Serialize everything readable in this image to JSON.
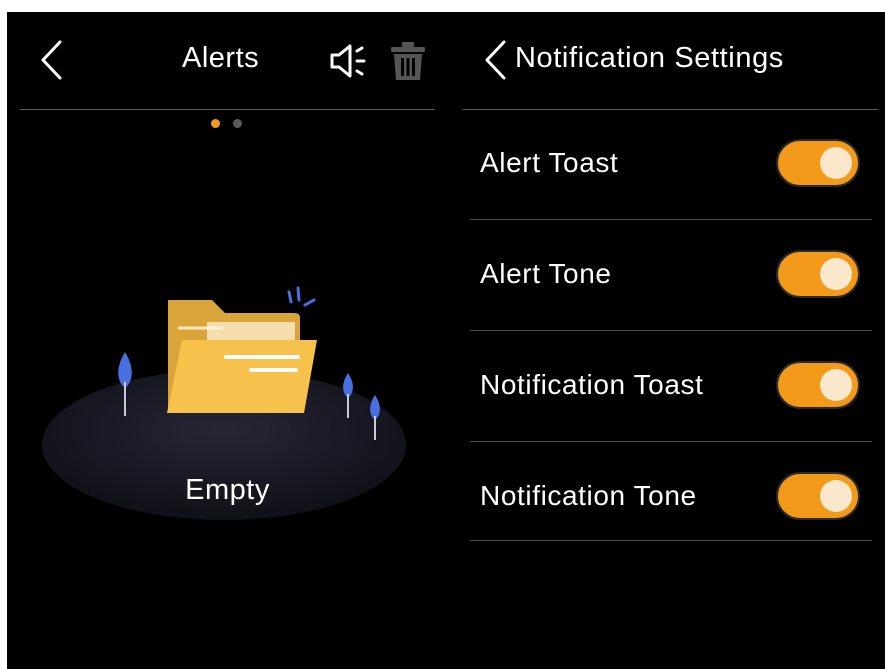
{
  "alerts_panel": {
    "title": "Alerts",
    "empty_label": "Empty",
    "page_indicator": {
      "current": 1,
      "total": 2
    }
  },
  "settings_panel": {
    "title": "Notification Settings",
    "items": [
      {
        "label": "Alert Toast",
        "enabled": true
      },
      {
        "label": "Alert Tone",
        "enabled": true
      },
      {
        "label": "Notification Toast",
        "enabled": true
      },
      {
        "label": "Notification Tone",
        "enabled": true
      }
    ]
  },
  "colors": {
    "background": "#000000",
    "accent": "#f39a1a",
    "divider": "#5a5a5a",
    "folder": "#f6c24b",
    "leaf": "#4a6fe0"
  },
  "icons": {
    "back": "chevron-left-icon",
    "speaker": "speaker-icon",
    "trash": "trash-icon",
    "empty_state": "empty-folder-illustration"
  }
}
